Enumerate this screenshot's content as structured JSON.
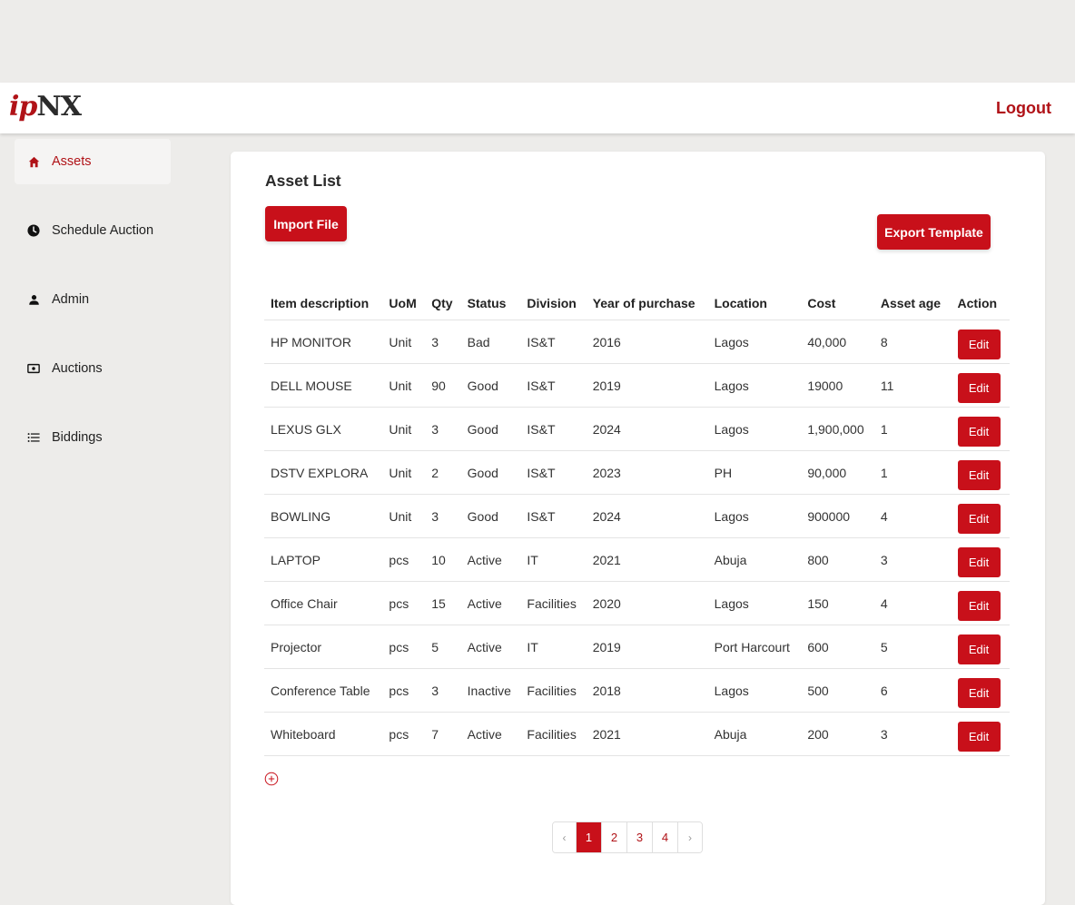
{
  "header": {
    "logo_ip": "ip",
    "logo_nx": "NX",
    "logout_label": "Logout"
  },
  "sidebar": {
    "items": [
      {
        "label": "Assets",
        "icon": "home-icon",
        "active": true
      },
      {
        "label": "Schedule Auction",
        "icon": "clock-icon",
        "active": false
      },
      {
        "label": "Admin",
        "icon": "user-icon",
        "active": false
      },
      {
        "label": "Auctions",
        "icon": "ticket-icon",
        "active": false
      },
      {
        "label": "Biddings",
        "icon": "list-icon",
        "active": false
      }
    ]
  },
  "main": {
    "title": "Asset List",
    "import_label": "Import File",
    "export_label": "Export Template",
    "table": {
      "headers": [
        "Item description",
        "UoM",
        "Qty",
        "Status",
        "Division",
        "Year of purchase",
        "Location",
        "Cost",
        "Asset age",
        "Action"
      ],
      "rows": [
        [
          "HP MONITOR",
          "Unit",
          "3",
          "Bad",
          "IS&T",
          "2016",
          "Lagos",
          "40,000",
          "8"
        ],
        [
          "DELL MOUSE",
          "Unit",
          "90",
          "Good",
          "IS&T",
          "2019",
          "Lagos",
          "19000",
          "11"
        ],
        [
          "LEXUS GLX",
          "Unit",
          "3",
          "Good",
          "IS&T",
          "2024",
          "Lagos",
          "1,900,000",
          "1"
        ],
        [
          "DSTV EXPLORA",
          "Unit",
          "2",
          "Good",
          "IS&T",
          "2023",
          "PH",
          "90,000",
          "1"
        ],
        [
          "BOWLING",
          "Unit",
          "3",
          "Good",
          "IS&T",
          "2024",
          "Lagos",
          "900000",
          "4"
        ],
        [
          "LAPTOP",
          "pcs",
          "10",
          "Active",
          "IT",
          "2021",
          "Abuja",
          "800",
          "3"
        ],
        [
          "Office Chair",
          "pcs",
          "15",
          "Active",
          "Facilities",
          "2020",
          "Lagos",
          "150",
          "4"
        ],
        [
          "Projector",
          "pcs",
          "5",
          "Active",
          "IT",
          "2019",
          "Port Harcourt",
          "600",
          "5"
        ],
        [
          "Conference Table",
          "pcs",
          "3",
          "Inactive",
          "Facilities",
          "2018",
          "Lagos",
          "500",
          "6"
        ],
        [
          "Whiteboard",
          "pcs",
          "7",
          "Active",
          "Facilities",
          "2021",
          "Abuja",
          "200",
          "3"
        ]
      ],
      "edit_label": "Edit"
    },
    "pagination": {
      "prev": "‹",
      "pages": [
        "1",
        "2",
        "3",
        "4"
      ],
      "current": "1",
      "next": "›"
    }
  },
  "colors": {
    "accent": "#c8101a",
    "brand_text": "#b01217",
    "background": "#edecea"
  }
}
